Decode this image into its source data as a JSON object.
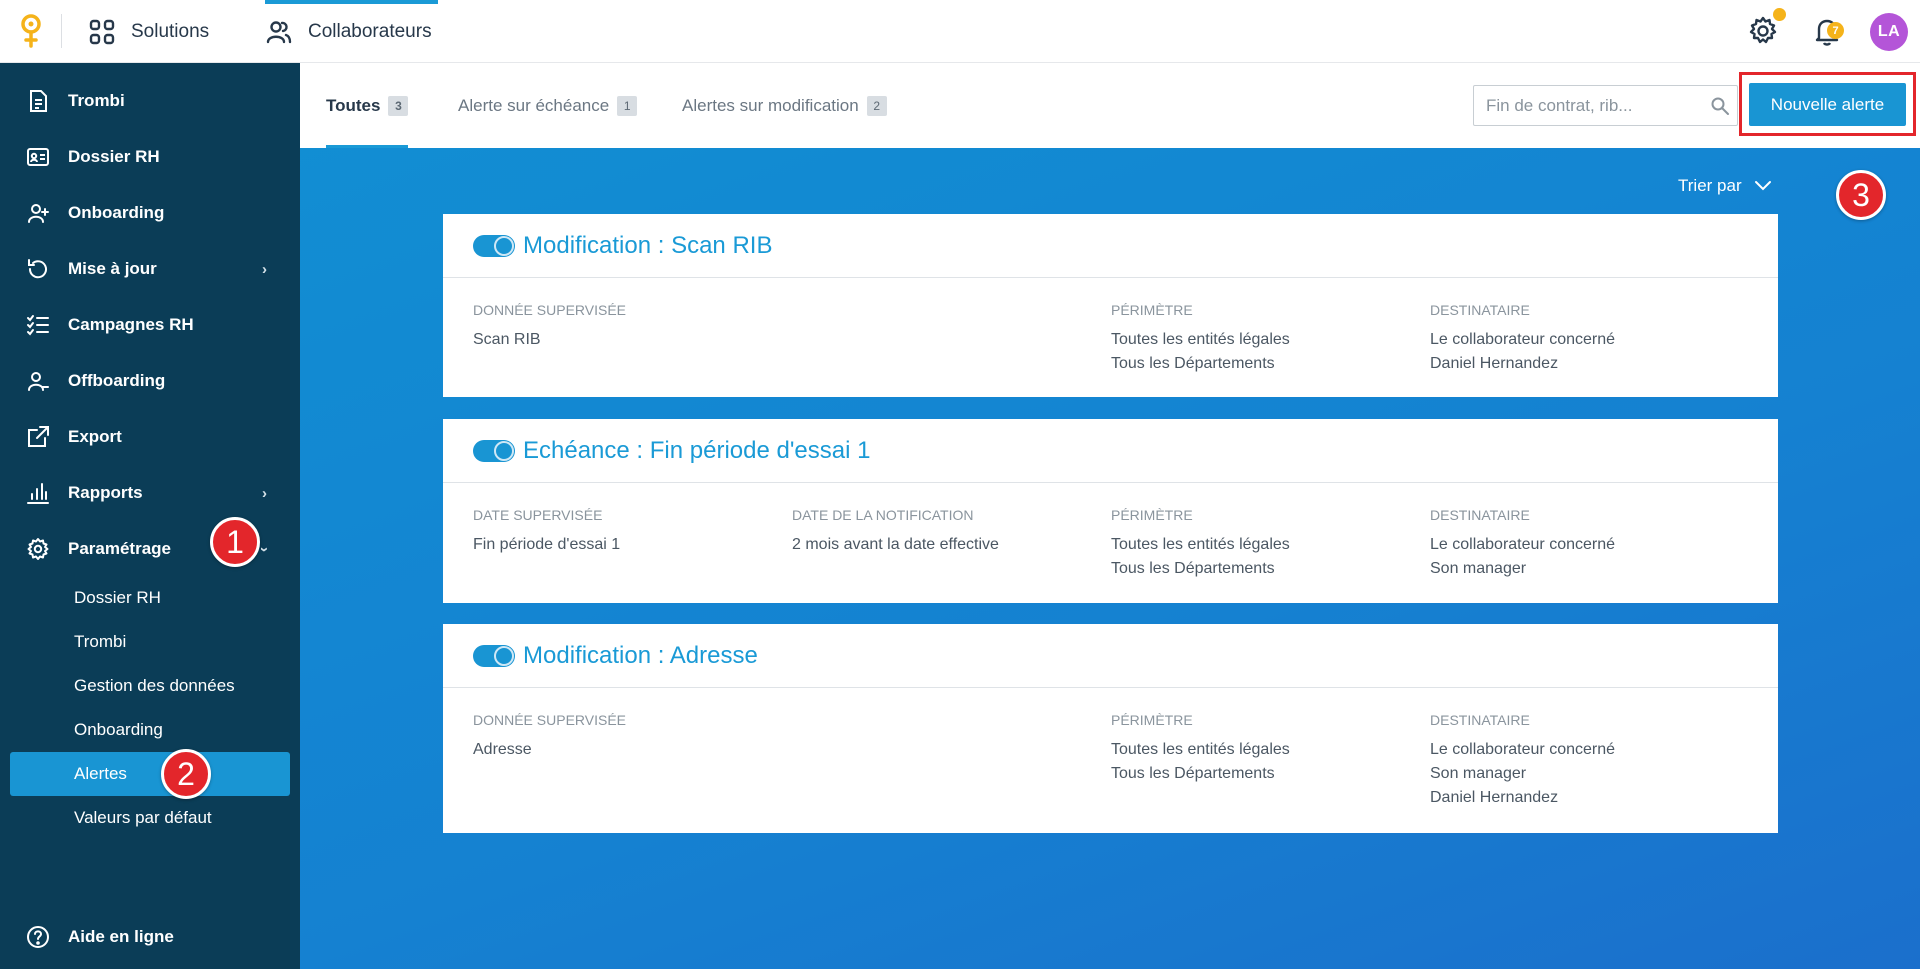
{
  "topbar": {
    "solutions_label": "Solutions",
    "collaborateurs_label": "Collaborateurs",
    "notifications_count": "7",
    "avatar_initials": "LA",
    "accent_color": "#1a9ad6",
    "brand_color": "#f5b31a"
  },
  "sidebar": {
    "items": [
      {
        "label": "Trombi",
        "icon": "document-icon"
      },
      {
        "label": "Dossier RH",
        "icon": "id-card-icon"
      },
      {
        "label": "Onboarding",
        "icon": "user-plus-icon"
      },
      {
        "label": "Mise à jour",
        "icon": "refresh-icon"
      },
      {
        "label": "Campagnes RH",
        "icon": "checklist-icon"
      },
      {
        "label": "Offboarding",
        "icon": "user-minus-icon"
      },
      {
        "label": "Export",
        "icon": "external-link-icon"
      },
      {
        "label": "Rapports",
        "icon": "bar-chart-icon"
      },
      {
        "label": "Paramétrage",
        "icon": "gear-icon"
      }
    ],
    "sub_items": [
      {
        "label": "Dossier RH"
      },
      {
        "label": "Trombi"
      },
      {
        "label": "Gestion des données"
      },
      {
        "label": "Onboarding"
      },
      {
        "label": "Alertes"
      },
      {
        "label": "Valeurs par défaut"
      }
    ],
    "help_label": "Aide en ligne",
    "background_color": "#0b3d57"
  },
  "markers": [
    "1",
    "2",
    "3"
  ],
  "tabs": [
    {
      "label": "Toutes",
      "count": "3"
    },
    {
      "label": "Alerte sur échéance",
      "count": "1"
    },
    {
      "label": "Alertes sur modification",
      "count": "2"
    }
  ],
  "search": {
    "placeholder": "Fin de contrat, rib..."
  },
  "new_alert_label": "Nouvelle alerte",
  "sort_label": "Trier par",
  "cards": [
    {
      "title": "Modification : Scan RIB",
      "col1_header": "DONNÉE SUPERVISÉE",
      "col1_value": "Scan RIB",
      "perimetre_header": "PÉRIMÈTRE",
      "perimetre_values": [
        "Toutes les entités légales",
        "Tous les Départements"
      ],
      "destinataire_header": "DESTINATAIRE",
      "destinataire_values": [
        "Le collaborateur concerné",
        "Daniel Hernandez"
      ]
    },
    {
      "title": "Echéance : Fin période d'essai 1",
      "col1_header": "DATE SUPERVISÉE",
      "col1_value": "Fin période d'essai 1",
      "col2_header": "DATE DE LA NOTIFICATION",
      "col2_value": "2 mois avant la date effective",
      "perimetre_header": "PÉRIMÈTRE",
      "perimetre_values": [
        "Toutes les entités légales",
        "Tous les Départements"
      ],
      "destinataire_header": "DESTINATAIRE",
      "destinataire_values": [
        "Le collaborateur concerné",
        "Son manager"
      ]
    },
    {
      "title": "Modification : Adresse",
      "col1_header": "DONNÉE SUPERVISÉE",
      "col1_value": "Adresse",
      "perimetre_header": "PÉRIMÈTRE",
      "perimetre_values": [
        "Toutes les entités légales",
        "Tous les Départements"
      ],
      "destinataire_header": "DESTINATAIRE",
      "destinataire_values": [
        "Le collaborateur concerné",
        "Son manager",
        "Daniel Hernandez"
      ]
    }
  ]
}
